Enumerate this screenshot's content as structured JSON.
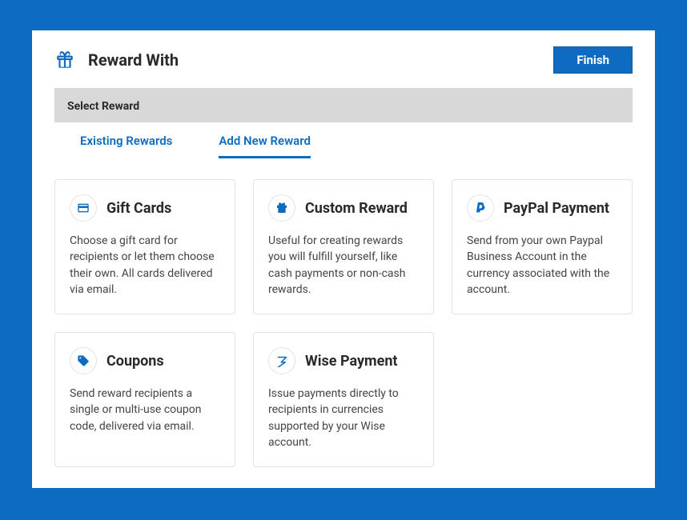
{
  "header": {
    "title": "Reward With",
    "finish_label": "Finish"
  },
  "select_bar": {
    "label": "Select Reward"
  },
  "tabs": {
    "existing": "Existing Rewards",
    "add_new": "Add New Reward"
  },
  "rewards": {
    "gift_cards": {
      "title": "Gift Cards",
      "desc": "Choose a gift card for recipients or let them choose their own. All cards delivered via email."
    },
    "custom": {
      "title": "Custom Reward",
      "desc": "Useful for creating rewards you will fulfill yourself, like cash payments or non-cash rewards."
    },
    "paypal": {
      "title": "PayPal Payment",
      "desc": "Send from your own Paypal Business Account in the currency associated with the account."
    },
    "coupons": {
      "title": "Coupons",
      "desc": "Send reward recipients a single or multi-use coupon code, delivered via email."
    },
    "wise": {
      "title": "Wise Payment",
      "desc": "Issue payments directly to recipients in currencies supported by your Wise account."
    }
  }
}
